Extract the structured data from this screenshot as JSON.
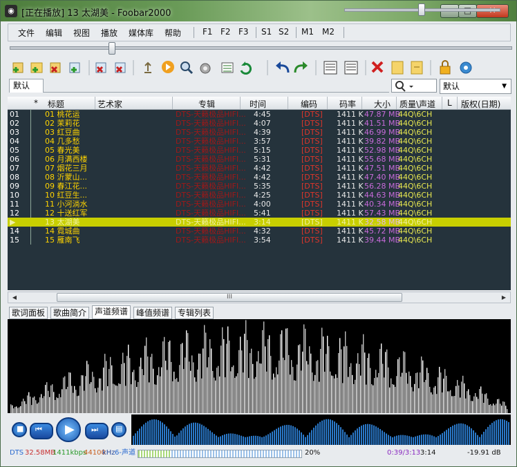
{
  "window": {
    "title": "[正在播放] 13 太湖美 - Foobar2000",
    "min": "–",
    "max": "□",
    "close": "✕"
  },
  "menu": {
    "items": [
      "文件",
      "编辑",
      "视图",
      "播放",
      "媒体库",
      "帮助"
    ],
    "presets": [
      "F1",
      "F2",
      "F3",
      "S1",
      "S2",
      "M1",
      "M2"
    ]
  },
  "volume_level": 0.5,
  "seek_position": 0.2,
  "playlist_tab": "默认",
  "search": {
    "mode_value": "默认",
    "dropdown_arrow": "▼"
  },
  "columns": [
    "*",
    "标题",
    "艺术家",
    "专辑",
    "时间",
    "编码",
    "码率",
    "大小",
    "质量\\声道",
    "L",
    "版权(日期)"
  ],
  "tracks": [
    {
      "idx": "01",
      "title": "01 桃花运",
      "album": "DTS-天籁极品HIFI...",
      "time": "4:45",
      "codec": "[DTS]",
      "rate": "1411 K",
      "size": "47.87 MB",
      "quality": "44Q\\6CH"
    },
    {
      "idx": "02",
      "title": "02 茉莉花",
      "album": "DTS-天籁极品HIFI...",
      "time": "4:07",
      "codec": "[DTS]",
      "rate": "1411 K",
      "size": "41.51 MB",
      "quality": "44Q\\6CH"
    },
    {
      "idx": "03",
      "title": "03 红豆曲",
      "album": "DTS-天籁极品HIFI...",
      "time": "4:39",
      "codec": "[DTS]",
      "rate": "1411 K",
      "size": "46.99 MB",
      "quality": "44Q\\6CH"
    },
    {
      "idx": "04",
      "title": "04 几多愁",
      "album": "DTS-天籁极品HIFI...",
      "time": "3:57",
      "codec": "[DTS]",
      "rate": "1411 K",
      "size": "39.82 MB",
      "quality": "44Q\\6CH"
    },
    {
      "idx": "05",
      "title": "05 春光美",
      "album": "DTS-天籁极品HIFI...",
      "time": "5:15",
      "codec": "[DTS]",
      "rate": "1411 K",
      "size": "52.98 MB",
      "quality": "44Q\\6CH"
    },
    {
      "idx": "06",
      "title": "06 月满西楼",
      "album": "DTS-天籁极品HIFI...",
      "time": "5:31",
      "codec": "[DTS]",
      "rate": "1411 K",
      "size": "55.68 MB",
      "quality": "44Q\\6CH"
    },
    {
      "idx": "07",
      "title": "07 烟花三月",
      "album": "DTS-天籁极品HIFI...",
      "time": "4:42",
      "codec": "[DTS]",
      "rate": "1411 K",
      "size": "47.51 MB",
      "quality": "44Q\\6CH"
    },
    {
      "idx": "08",
      "title": "08 沂蒙山...",
      "album": "DTS-天籁极品HIFI...",
      "time": "4:42",
      "codec": "[DTS]",
      "rate": "1411 K",
      "size": "47.40 MB",
      "quality": "44Q\\6CH"
    },
    {
      "idx": "09",
      "title": "09 春江花...",
      "album": "DTS-天籁极品HIFI...",
      "time": "5:35",
      "codec": "[DTS]",
      "rate": "1411 K",
      "size": "56.28 MB",
      "quality": "44Q\\6CH"
    },
    {
      "idx": "10",
      "title": "10 红豆生...",
      "album": "DTS-天籁极品HIFI...",
      "time": "4:25",
      "codec": "[DTS]",
      "rate": "1411 K",
      "size": "44.63 MB",
      "quality": "44Q\\6CH"
    },
    {
      "idx": "11",
      "title": "11 小河淌水",
      "album": "DTS-天籁极品HIFI...",
      "time": "4:00",
      "codec": "[DTS]",
      "rate": "1411 K",
      "size": "40.34 MB",
      "quality": "44Q\\6CH"
    },
    {
      "idx": "12",
      "title": "12 十送红军",
      "album": "DTS-天籁极品HIFI...",
      "time": "5:41",
      "codec": "[DTS]",
      "rate": "1411 K",
      "size": "57.43 MB",
      "quality": "44Q\\6CH"
    },
    {
      "idx": "▶",
      "title": "13 太湖美",
      "album": "DTS-天籁极品HIFI...",
      "time": "3:14",
      "codec": "[DTS]",
      "rate": "1411 K",
      "size": "32.58 MB",
      "quality": "44Q\\6CH",
      "playing": true
    },
    {
      "idx": "14",
      "title": "14 霓城曲",
      "album": "DTS-天籁极品HIFI...",
      "time": "4:32",
      "codec": "[DTS]",
      "rate": "1411 K",
      "size": "45.72 MB",
      "quality": "44Q\\6CH"
    },
    {
      "idx": "15",
      "title": "15 雁南飞",
      "album": "DTS-天籁极品HIFI...",
      "time": "3:54",
      "codec": "[DTS]",
      "rate": "1411 K",
      "size": "39.44 MB",
      "quality": "44Q\\6CH"
    }
  ],
  "bottom_tabs": [
    "歌词面板",
    "歌曲简介",
    "声道频谱",
    "峰值频谱",
    "专辑列表"
  ],
  "active_bottom_tab": 2,
  "status": {
    "codec": "DTS",
    "size": "32.58MB",
    "bitrate": "1411kbps",
    "samplerate": "44100",
    "khz": "kHz",
    "channels": "6-声道",
    "buffer": "20%",
    "position": "0:39/3:13",
    "length": "3:14",
    "replaygain": "-19.91 dB"
  },
  "scroll": {
    "thumb_glyph": "III",
    "left_arrow": "◀",
    "right_arrow": "▶"
  },
  "transport": {
    "stop_icon": "■",
    "prev_icon": "⏮",
    "play_icon": "▶",
    "next_icon": "⏭",
    "open_icon": "▤"
  },
  "colors": {
    "accent": "#c8cf00",
    "playlist_bg": "#25333c",
    "title_color": "#ffd400"
  }
}
